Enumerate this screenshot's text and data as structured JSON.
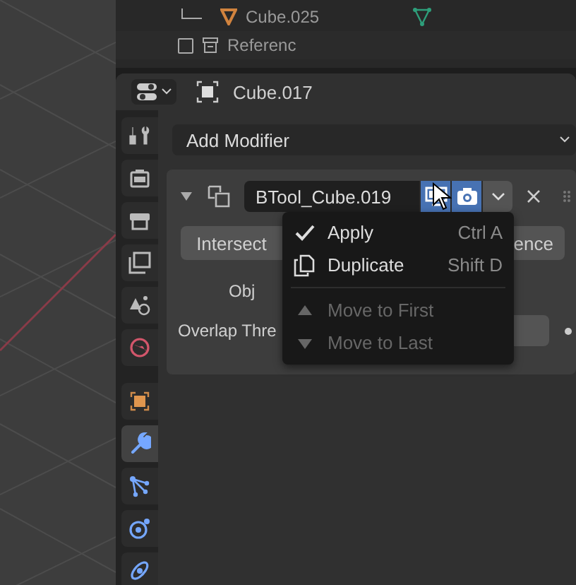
{
  "outliner": {
    "rows": [
      {
        "kind": "mesh",
        "label": "Cube.025"
      },
      {
        "kind": "collection",
        "label": "Referenc",
        "checked": false
      }
    ]
  },
  "properties": {
    "object_name": "Cube.017",
    "tabs": [
      {
        "selected": false
      },
      {
        "selected": false
      },
      {
        "selected": false
      },
      {
        "selected": false
      },
      {
        "selected": false
      },
      {
        "selected": false
      },
      {
        "selected": false
      },
      {
        "selected": true
      },
      {
        "selected": false
      },
      {
        "selected": false
      },
      {
        "selected": false
      }
    ],
    "add_modifier": "Add Modifier",
    "modifier": {
      "expanded": true,
      "name": "BTool_Cube.019",
      "show_viewport": true,
      "show_render": true,
      "operations": [
        {
          "label": "Intersect",
          "selected": false
        },
        {
          "label": "ence",
          "selected": false
        }
      ],
      "object_label": "Obj",
      "threshold_label": "Overlap Thre"
    }
  },
  "context_menu": {
    "items": [
      {
        "label": "Apply",
        "shortcut": "Ctrl A",
        "disabled": false
      },
      {
        "label": "Duplicate",
        "shortcut": "Shift D",
        "disabled": false
      },
      {
        "label": "Move to First",
        "disabled": true
      },
      {
        "label": "Move to Last",
        "disabled": true
      }
    ]
  }
}
